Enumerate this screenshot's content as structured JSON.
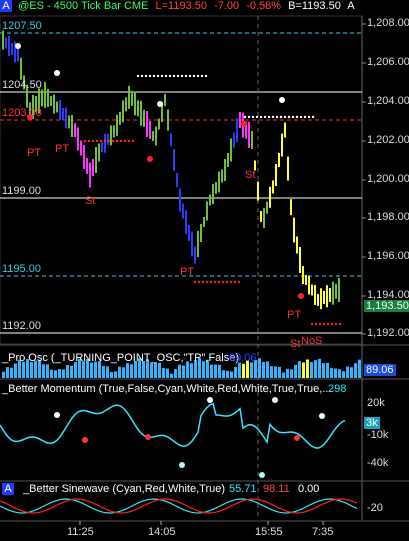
{
  "header": {
    "a_button": "A",
    "symbol": "@ES - 4500 Tick Bar  CME",
    "last": "L=1193.50",
    "change": "-7.00",
    "change_pct": "-0.58%",
    "bid": "B=1193.50",
    "more": "A"
  },
  "main_pane": {
    "price_axis": [
      "1,208.00",
      "1,206.00",
      "1,204.00",
      "1,202.00",
      "1,200.00",
      "1,198.00",
      "1,196.00",
      "1,194.00",
      "1,192.00"
    ],
    "current_price_tag": "1,193.50",
    "level_labels": {
      "l1207": "1207.50",
      "l1204": "1204.50",
      "l1203": "1203.00",
      "l1199": "1199.00",
      "l1195": "1195.00",
      "l1192": "1192.00"
    },
    "markers": {
      "pt1": "PT",
      "pt2": "PT",
      "st1": "St",
      "pt3": "PT",
      "st2": "St",
      "pt4": "PT",
      "st3": "St",
      "nos": "NoS"
    }
  },
  "pro_osc": {
    "label": "_Pro Osc (_TURNING_POINT_OSC,\"TP\",False)",
    "value": "89.06",
    "axis_tag": "89.06"
  },
  "momentum": {
    "label": "_Better Momentum (True,False,Cyan,White,Red,White,True,True,...",
    "value": "298",
    "axis": [
      "20k",
      "-10k",
      "-40k"
    ],
    "tag": "3k"
  },
  "sinewave": {
    "a_button": "A",
    "label": "_Better Sinewave (Cyan,Red,White,True)",
    "v1": "55.71",
    "v2": "98.11",
    "v3": "0.00",
    "axis": [
      "-20"
    ]
  },
  "time_axis": [
    "11:25",
    "14:05",
    "15:55",
    "7:35"
  ],
  "colors": {
    "up_bar": "#6fbf3a",
    "down_bar": "#2a3cff",
    "yellow_bar": "#ffff33",
    "magenta_bar": "#ff33ff",
    "red_dots": "#ff2222",
    "white_dots": "#ffffff",
    "cyan_line": "#33e6ff",
    "price_tag_bg": "#1a7f3c"
  }
}
